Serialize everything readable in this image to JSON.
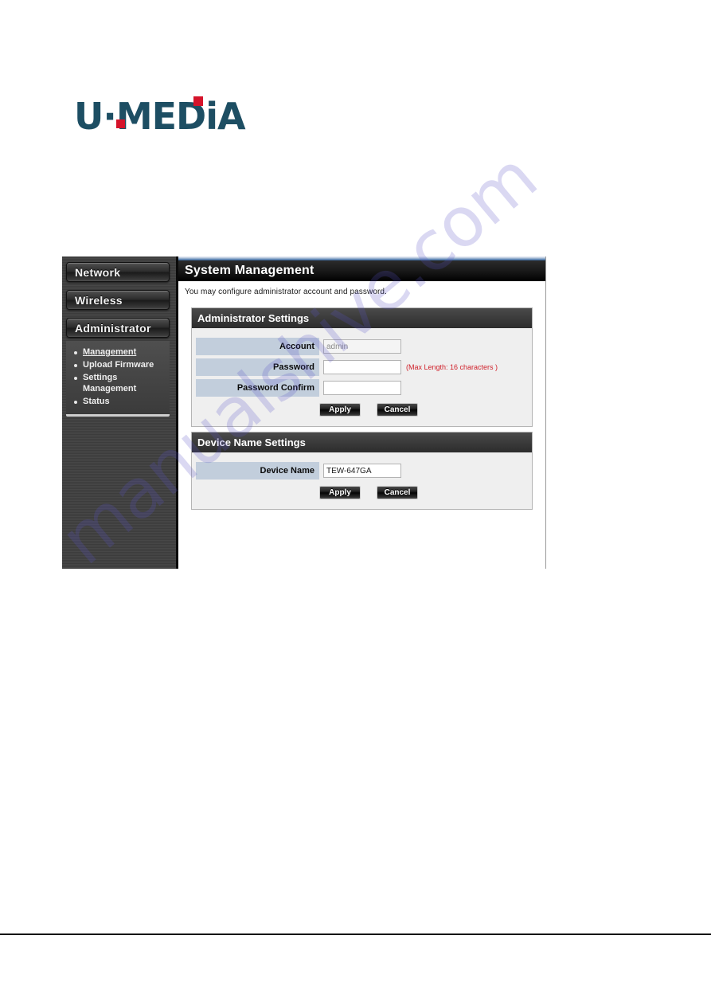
{
  "brand": {
    "logo_text": "U·MEDiA",
    "logo_color": "#1d4e63",
    "accent_color": "#d5132a"
  },
  "watermark": {
    "text": "manualshive.com",
    "color": "#5a54c8"
  },
  "sidebar": {
    "nav": [
      {
        "label": "Network"
      },
      {
        "label": "Wireless"
      },
      {
        "label": "Administrator"
      }
    ],
    "submenu": [
      {
        "label": "Management",
        "active": true
      },
      {
        "label": "Upload Firmware",
        "active": false
      },
      {
        "label": "Settings Management",
        "active": false
      },
      {
        "label": "Status",
        "active": false
      }
    ]
  },
  "page": {
    "title": "System Management",
    "description": "You may configure administrator account and password."
  },
  "admin_settings": {
    "heading": "Administrator Settings",
    "fields": [
      {
        "label": "Account",
        "value": "admin",
        "placeholder": "",
        "disabled": true,
        "hint": ""
      },
      {
        "label": "Password",
        "value": "",
        "placeholder": "",
        "disabled": false,
        "hint": "(Max Length: 16 characters )"
      },
      {
        "label": "Password Confirm",
        "value": "",
        "placeholder": "",
        "disabled": false,
        "hint": ""
      }
    ],
    "apply_label": "Apply",
    "cancel_label": "Cancel"
  },
  "device_settings": {
    "heading": "Device Name Settings",
    "fields": [
      {
        "label": "Device Name",
        "value": "TEW-647GA",
        "placeholder": "",
        "disabled": false,
        "hint": ""
      }
    ],
    "apply_label": "Apply",
    "cancel_label": "Cancel"
  }
}
